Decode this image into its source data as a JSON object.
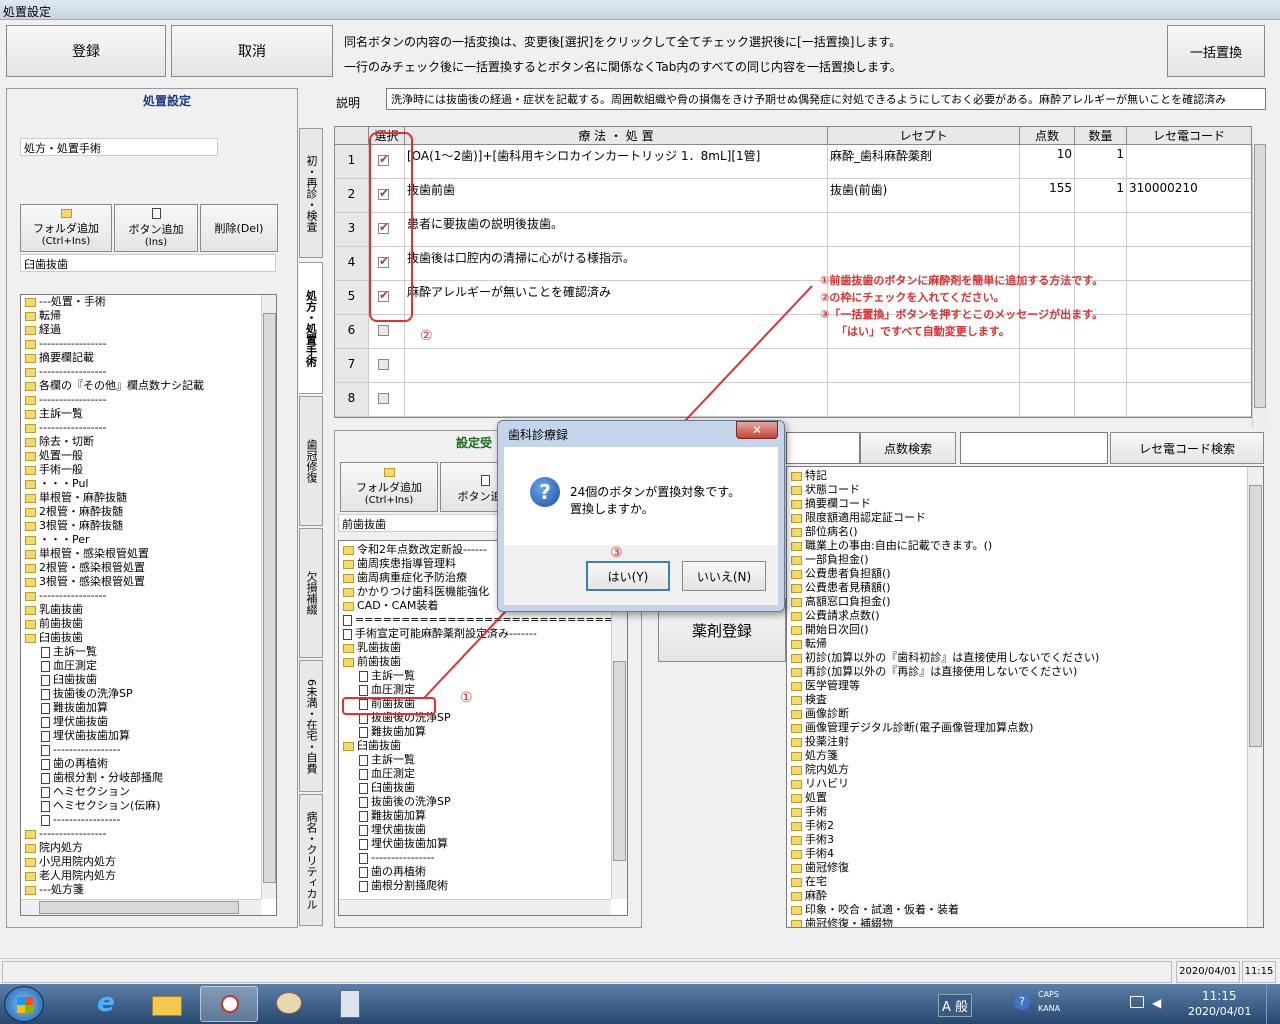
{
  "window": {
    "title": "処置設定"
  },
  "toolbar": {
    "register": "登録",
    "cancel": "取消",
    "bulk_replace": "一括置換"
  },
  "notice": [
    "同名ボタンの内容の一括変換は、変更後[選択]をクリックして全てチェック選択後に[一括置換]します。",
    "一行のみチェック後に一括置換するとボタン名に関係なくTab内のすべての同じ内容を一括置換します。"
  ],
  "description": {
    "label": "説明",
    "value": "洗浄時には抜歯後の経過・症状を記載する。周囲軟組織や骨の損傷をきけ予期せぬ偶発症に対処できるようにしておく必要がある。麻酔アレルギーが無いことを確認済み"
  },
  "left_panel": {
    "title": "処置設定",
    "category_value": "処方・処置手術",
    "folder_add": "フォルダ追加",
    "folder_add_key": "(Ctrl+Ins)",
    "button_add": "ボタン追加",
    "button_add_key": "(Ins)",
    "delete": "削除(Del)",
    "selected_value": "臼歯抜歯",
    "tree": [
      "---処置・手術",
      "転帰",
      "経過",
      "-----------------",
      "摘要欄記載",
      "-----------------",
      "各欄の『その他』欄点数ナシ記載",
      "-----------------",
      "主訴一覧",
      "-----------------",
      "除去・切断",
      "処置一般",
      "手術一般",
      "・・・Pul",
      "単根管・麻酔抜髄",
      "2根管・麻酔抜髄",
      "3根管・麻酔抜髄",
      "・・・Per",
      "単根管・感染根管処置",
      "2根管・感染根管処置",
      "3根管・感染根管処置",
      "-----------------",
      "乳歯抜歯",
      "前歯抜歯",
      "臼歯抜歯",
      "主訴一覧",
      "血圧測定",
      "臼歯抜歯",
      "抜歯後の洗浄SP",
      "難抜歯加算",
      "埋伏歯抜歯",
      "埋伏歯抜歯加算",
      "-----------------",
      "歯の再植術",
      "歯根分割・分岐部搔爬",
      "ヘミセクション",
      "ヘミセクション(伝麻)",
      "-----------------",
      "-----------------",
      "院内処方",
      "小児用院内処方",
      "老人用院内処方",
      "---処方箋"
    ]
  },
  "tabs": [
    "初・再診・検査",
    "処方・処置手術",
    "歯冠修復",
    "欠損補綴",
    "6未満・在宅・自費",
    "病名・クリティカル"
  ],
  "grid": {
    "headers": [
      "選択",
      "療 法 ・ 処 置",
      "レセプト",
      "点数",
      "数量",
      "レセ電コード"
    ],
    "rows": [
      {
        "no": "1",
        "checked": true,
        "treatment": "[OA(1～2歯)]+[歯科用キシロカインカートリッジ 1．8mL][1管]",
        "receipt": "麻酔_歯科麻酔薬剤",
        "points": "10",
        "qty": "1",
        "code": ""
      },
      {
        "no": "2",
        "checked": true,
        "treatment": "抜歯前歯",
        "receipt": "抜歯(前歯)",
        "points": "155",
        "qty": "1",
        "code": "310000210"
      },
      {
        "no": "3",
        "checked": true,
        "treatment": "患者に要抜歯の説明後抜歯。",
        "receipt": "",
        "points": "",
        "qty": "",
        "code": ""
      },
      {
        "no": "4",
        "checked": true,
        "treatment": "抜歯後は口腔内の清掃に心がける様指示。",
        "receipt": "",
        "points": "",
        "qty": "",
        "code": ""
      },
      {
        "no": "5",
        "checked": true,
        "treatment": "麻酔アレルギーが無いことを確認済み",
        "receipt": "",
        "points": "",
        "qty": "",
        "code": ""
      },
      {
        "no": "6",
        "checked": false,
        "treatment": "",
        "receipt": "",
        "points": "",
        "qty": "",
        "code": ""
      },
      {
        "no": "7",
        "checked": false,
        "treatment": "",
        "receipt": "",
        "points": "",
        "qty": "",
        "code": ""
      },
      {
        "no": "8",
        "checked": false,
        "treatment": "",
        "receipt": "",
        "points": "",
        "qty": "",
        "code": ""
      }
    ]
  },
  "annotations": {
    "circle2": "②",
    "circle1": "①",
    "circle3": "③",
    "note_lines": [
      "①前歯抜歯のボタンに麻酔剤を簡単に追加する方法です。",
      "②の枠にチェックを入れてください。",
      "③「一括置換」ボタンを押すとこのメッセージが出ます。",
      "「はい」ですべて自動変更します。"
    ]
  },
  "middle_panel": {
    "title": "設定受",
    "folder_add": "フォルダ追加",
    "folder_add_key": "(Ctrl+Ins)",
    "button_add": "ボタン追加",
    "selected_value": "前歯抜歯",
    "tree": [
      "令和2年点数改定新設------",
      "歯周疾患指導管理料",
      "歯周病重症化予防治療",
      "かかりつけ歯科医機能強化",
      "CAD・CAM装着",
      "================================",
      "手術宣定可能麻酔薬剤設定済み-------",
      "乳歯抜歯",
      "前歯抜歯",
      "主訴一覧",
      "血圧測定",
      "前歯抜歯",
      "抜歯後の洗浄SP",
      "難抜歯加算",
      "臼歯抜歯",
      "主訴一覧",
      "血圧測定",
      "臼歯抜歯",
      "抜歯後の洗浄SP",
      "難抜歯加算",
      "埋伏歯抜歯",
      "埋伏歯抜歯加算",
      "----------------",
      "歯の再植術",
      "歯根分割掻爬術"
    ],
    "drug_register": "薬剤登録"
  },
  "search": {
    "points_label": "点数検索",
    "code_label": "レセ電コード検索"
  },
  "right_tree": [
    "特記",
    "状態コード",
    "摘要欄コード",
    "限度額適用認定証コード",
    "部位病名()",
    "職業上の事由:自由に記載できます。()",
    "一部負担金()",
    "公費患者負担額()",
    "公費患者見積額()",
    "高額窓口負担金()",
    "公費請求点数()",
    "開始日次回()",
    "転帰",
    "初診(加算以外の『歯科初診』は直接使用しないでください)",
    "再診(加算以外の『再診』は直接使用しないでください)",
    "医学管理等",
    "検査",
    "画像診断",
    "画像管理デジタル診断(電子画像管理加算点数)",
    "投薬注射",
    "処方箋",
    "院内処方",
    "リハビリ",
    "処置",
    "手術",
    "手術2",
    "手術3",
    "手術4",
    "歯冠修復",
    "在宅",
    "麻酔",
    "印象・咬合・試適・仮着・装着",
    "歯冠修復・補綴物"
  ],
  "dialog": {
    "title": "歯科診療録",
    "message1": "24個のボタンが置換対象です。",
    "message2": "置換しますか。",
    "yes": "はい(Y)",
    "no": "いいえ(N)"
  },
  "statusbar": {
    "date": "2020/04/01",
    "time": "11:15"
  },
  "taskbar": {
    "ime": "A 般",
    "caps": "CAPS",
    "kana": "KANA",
    "clock_time": "11:15",
    "clock_date": "2020/04/01"
  }
}
